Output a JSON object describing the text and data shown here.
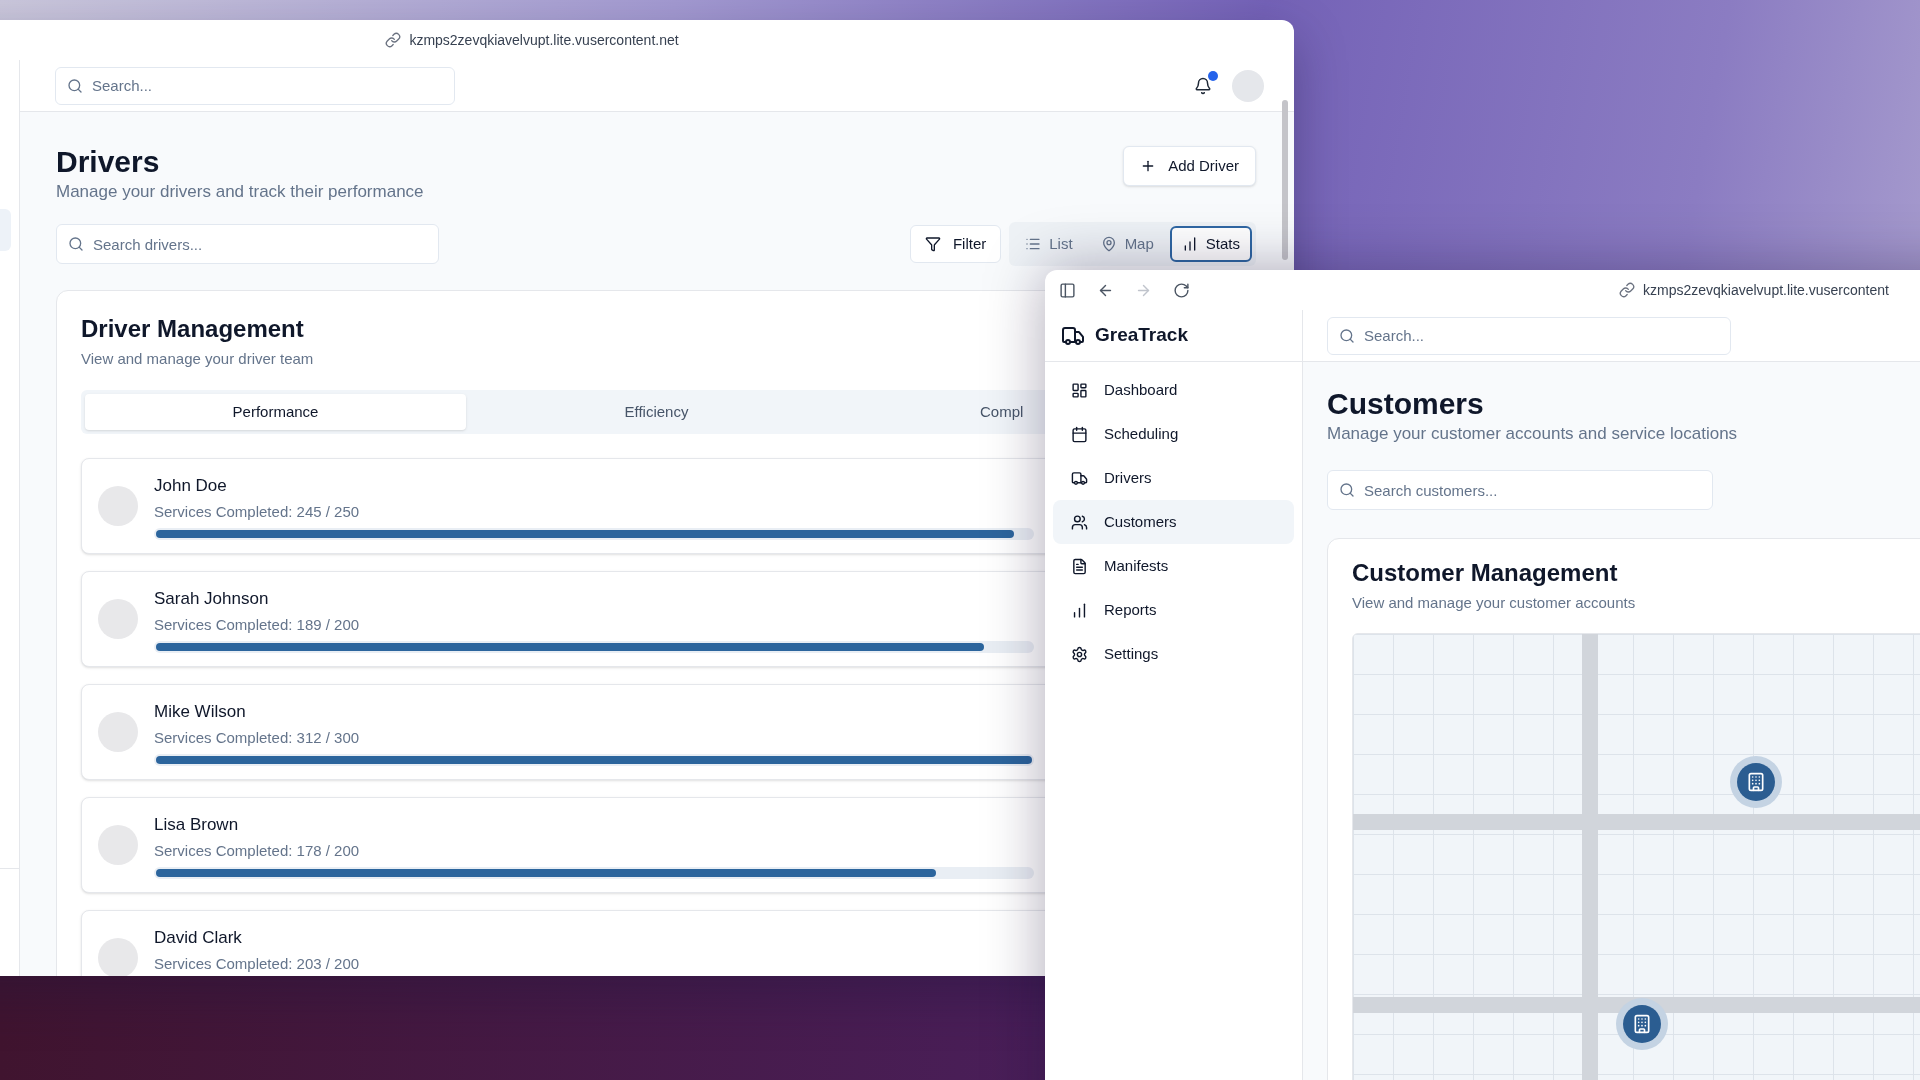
{
  "left_window": {
    "address_bar": {
      "url": "kzmps2zevqkiavelvupt.lite.vusercontent.net"
    },
    "sidebar": {
      "items": [
        {
          "selected": true
        }
      ]
    },
    "top_bar": {
      "search": {
        "placeholder": "Search..."
      },
      "notifications": {
        "unread": true
      }
    },
    "page": {
      "title": "Drivers",
      "subtitle": "Manage your drivers and track their performance",
      "add_button": "Add Driver",
      "search": {
        "placeholder": "Search drivers..."
      },
      "filter_button": "Filter",
      "views": [
        {
          "label": "List",
          "selected": false
        },
        {
          "label": "Map",
          "selected": false
        },
        {
          "label": "Stats",
          "selected": true
        }
      ]
    },
    "card": {
      "title": "Driver Management",
      "subtitle": "View and manage your driver team",
      "tabs": [
        {
          "label": "Performance",
          "selected": true
        },
        {
          "label": "Efficiency",
          "selected": false
        },
        {
          "label": "Compl",
          "selected": false
        }
      ],
      "drivers": [
        {
          "name": "John Doe",
          "services": "Services Completed: 245 / 250",
          "level": 0.98
        },
        {
          "name": "Sarah Johnson",
          "services": "Services Completed: 189 / 200",
          "level": 0.945
        },
        {
          "name": "Mike Wilson",
          "services": "Services Completed: 312 / 300",
          "level": 1
        },
        {
          "name": "Lisa Brown",
          "services": "Services Completed: 178 / 200",
          "level": 0.89
        },
        {
          "name": "David Clark",
          "services": "Services Completed: 203 / 200"
        }
      ]
    }
  },
  "right_window": {
    "toolbar": {
      "back_disabled": false,
      "forward_disabled": true
    },
    "address_bar": {
      "url": "kzmps2zevqkiavelvupt.lite.vusercontent"
    },
    "sidebar": {
      "brand": "GreaTrack",
      "items": [
        {
          "label": "Dashboard",
          "selected": false
        },
        {
          "label": "Scheduling",
          "selected": false
        },
        {
          "label": "Drivers",
          "selected": false
        },
        {
          "label": "Customers",
          "selected": true
        },
        {
          "label": "Manifests",
          "selected": false
        },
        {
          "label": "Reports",
          "selected": false
        },
        {
          "label": "Settings",
          "selected": false
        }
      ]
    },
    "top_bar": {
      "search": {
        "placeholder": "Search..."
      }
    },
    "page": {
      "title": "Customers",
      "subtitle": "Manage your customer accounts and service locations",
      "search": {
        "placeholder": "Search customers..."
      }
    },
    "card": {
      "title": "Customer Management",
      "subtitle": "View and manage your customer accounts"
    }
  }
}
